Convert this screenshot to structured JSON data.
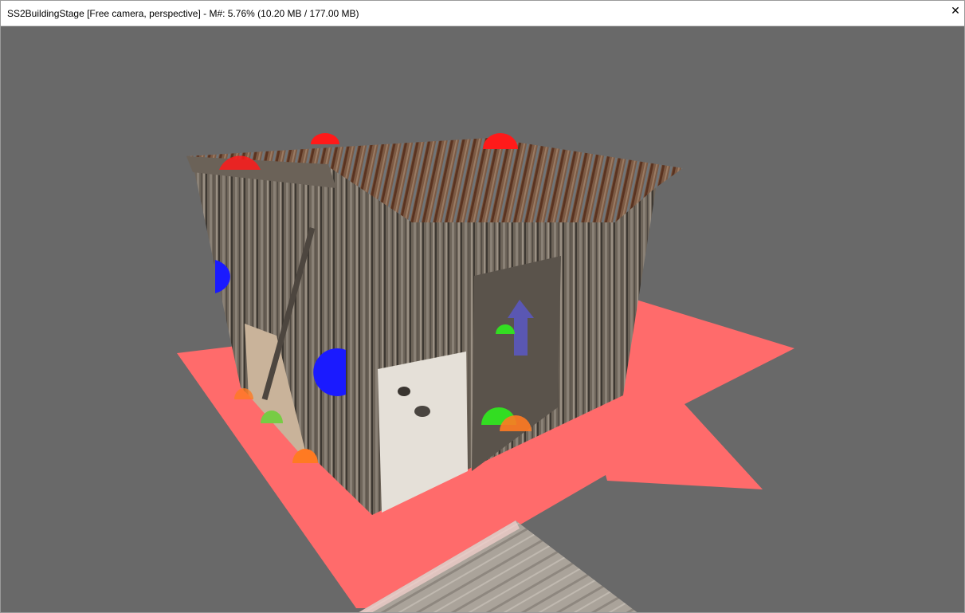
{
  "window": {
    "title": "SS2BuildingStage [Free camera, perspective] - M#: 5.76% (10.20 MB / 177.00 MB)",
    "close_glyph": "✕",
    "close_icon": "close-icon"
  },
  "viewport": {
    "background_color": "#696969",
    "ground_plane_color": "#ff6b6b",
    "marker_colors": {
      "red": "#ff1a1a",
      "blue": "#1a1aff",
      "green": "#33dd22",
      "orange": "#ff7a22"
    },
    "scene_objects": [
      "wooden-shack",
      "build-area-plane",
      "floor-tile"
    ]
  }
}
